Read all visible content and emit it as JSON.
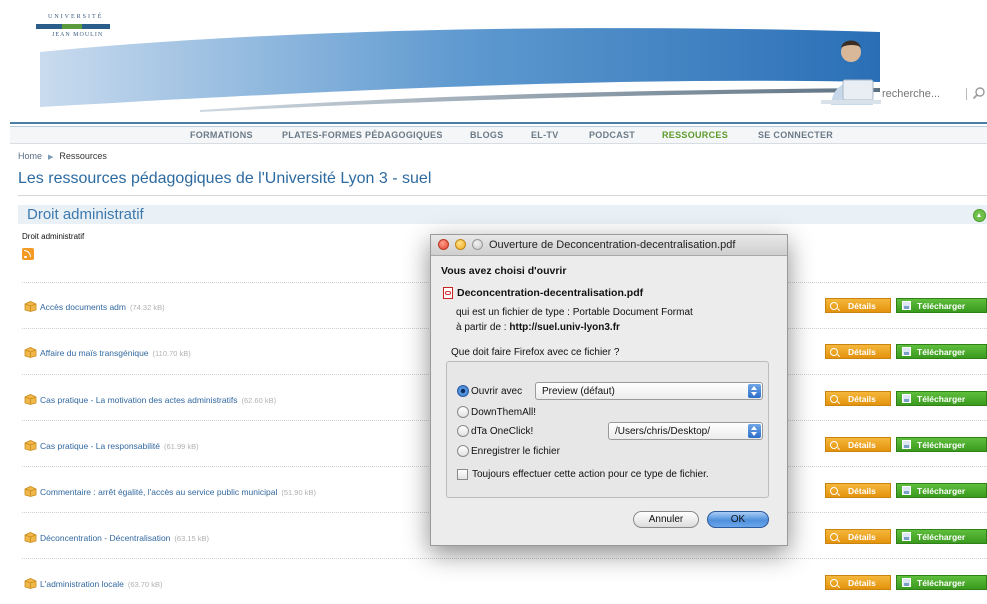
{
  "header": {
    "logo_top": "UNIVERSITÉ",
    "logo_bottom": "JEAN MOULIN",
    "search_placeholder": "recherche..."
  },
  "nav": {
    "items": [
      "FORMATIONS",
      "PLATES-FORMES PÉDAGOGIQUES",
      "BLOGS",
      "EL-TV",
      "PODCAST",
      "RESSOURCES",
      "SE CONNECTER"
    ],
    "active": "RESSOURCES"
  },
  "breadcrumb": {
    "home": "Home",
    "current": "Ressources"
  },
  "page_title": "Les ressources pédagogiques de l'Université Lyon 3 - suel",
  "section": {
    "title": "Droit administratif",
    "subtitle": "Droit administratif"
  },
  "resources": [
    {
      "title": "Accès documents adm",
      "size": "(74.32 kB)"
    },
    {
      "title": "Affaire du maïs transgénique",
      "size": "(110.70 kB)"
    },
    {
      "title": "Cas pratique - La motivation des actes administratifs",
      "size": "(62.60 kB)"
    },
    {
      "title": "Cas pratique - La responsabilité",
      "size": "(61.99 kB)"
    },
    {
      "title": "Commentaire : arrêt égalité, l'accès au service public municipal",
      "size": "(51.90 kB)"
    },
    {
      "title": "Déconcentration - Décentralisation",
      "size": "(63.15 kB)"
    },
    {
      "title": "L'administration locale",
      "size": "(63.70 kB)"
    }
  ],
  "buttons": {
    "details": "Détails",
    "download": "Télécharger"
  },
  "dialog": {
    "title": "Ouverture de Deconcentration-decentralisation.pdf",
    "heading": "Vous avez choisi d'ouvrir",
    "filename": "Deconcentration-decentralisation.pdf",
    "type_line": "qui est un fichier de type : Portable Document Format",
    "source_prefix": "à partir de :",
    "source_url": "http://suel.univ-lyon3.fr",
    "question": "Que doit faire Firefox avec ce fichier ?",
    "options": {
      "open_with": "Ouvrir avec",
      "open_with_app": "Preview (défaut)",
      "downthemall": "DownThemAll!",
      "dta_oneclick": "dTa OneClick!",
      "dta_path": "/Users/chris/Desktop/",
      "save": "Enregistrer le fichier"
    },
    "selected_option": "open_with",
    "always_checkbox": "Toujours effectuer cette action pour ce type de fichier.",
    "always_checked": false,
    "cancel": "Annuler",
    "ok": "OK"
  }
}
